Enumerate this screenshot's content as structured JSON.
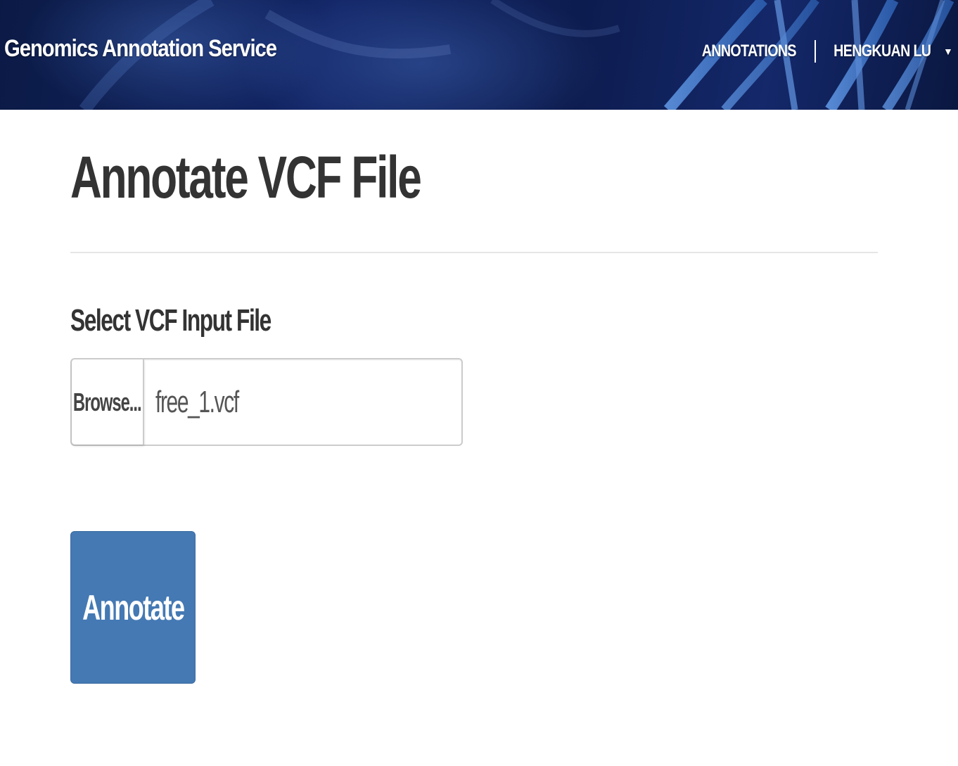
{
  "navbar": {
    "brand": "Genomics Annotation Service",
    "links": {
      "annotations": "ANNOTATIONS",
      "user": "HENGKUAN LU"
    },
    "user_menu_icon": "caret-down-icon",
    "background_color": "#122566"
  },
  "main": {
    "title": "Annotate VCF File",
    "form": {
      "file_label": "Select VCF Input File",
      "browse_label": "Browse...",
      "file_value": "free_1.vcf",
      "submit_label": "Annotate"
    }
  },
  "colors": {
    "primary_button": "#4479b3",
    "text": "#333333"
  }
}
